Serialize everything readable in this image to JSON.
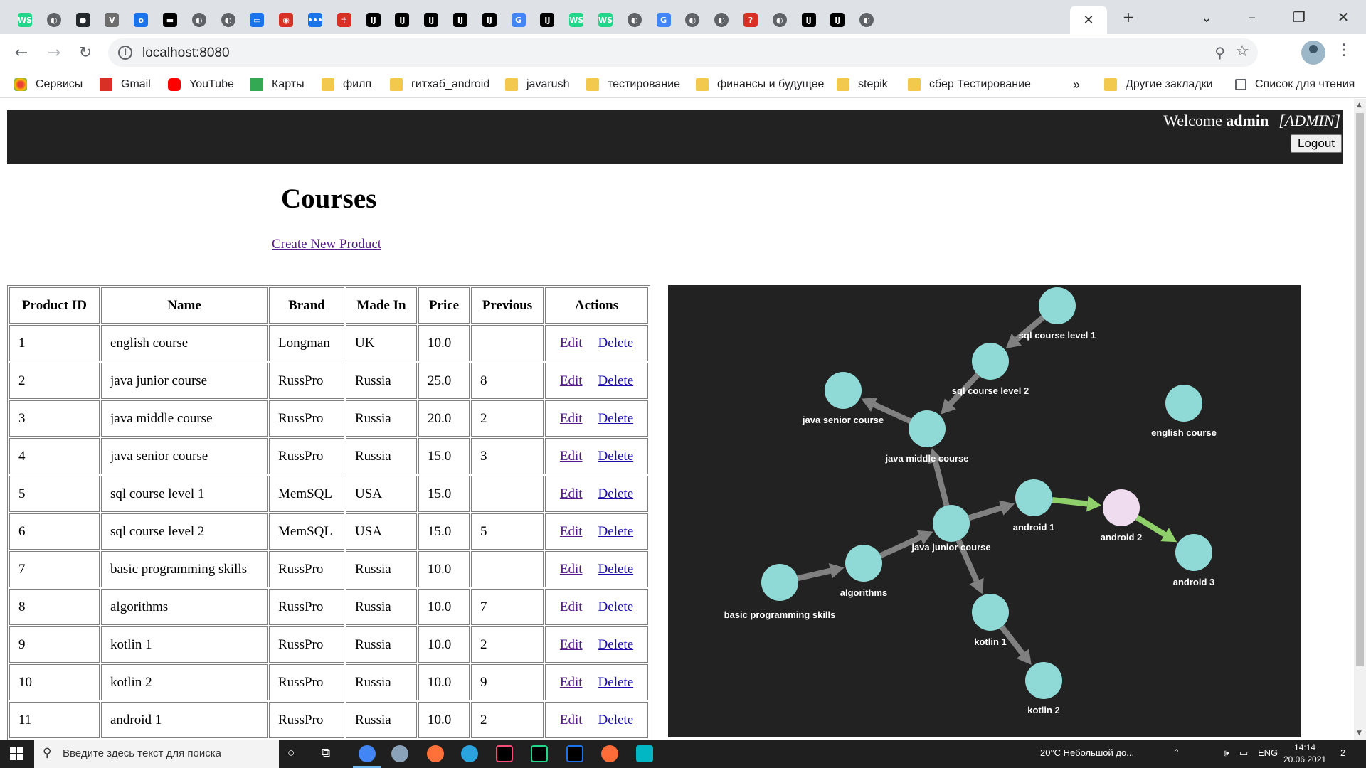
{
  "browser": {
    "tabs": [
      {
        "icon": "webstorm-icon",
        "color": "#21d789"
      },
      {
        "icon": "globe-icon",
        "color": "#5f6368"
      },
      {
        "icon": "github-icon",
        "color": "#24292e"
      },
      {
        "icon": "v-icon",
        "color": "#6d6d6d"
      },
      {
        "icon": "o-icon",
        "color": "#1a73e8"
      },
      {
        "icon": "chat-icon",
        "color": "#000000"
      },
      {
        "icon": "globe-icon",
        "color": "#5f6368"
      },
      {
        "icon": "globe-icon",
        "color": "#5f6368"
      },
      {
        "icon": "message-icon",
        "color": "#1a73e8"
      },
      {
        "icon": "record-icon",
        "color": "#d93025"
      },
      {
        "icon": "dots-icon",
        "color": "#1a73e8"
      },
      {
        "icon": "figure-icon",
        "color": "#d93025"
      },
      {
        "icon": "intellij-icon",
        "color": "#000000"
      },
      {
        "icon": "intellij-icon",
        "color": "#000000"
      },
      {
        "icon": "intellij-icon",
        "color": "#000000"
      },
      {
        "icon": "intellij-icon",
        "color": "#000000"
      },
      {
        "icon": "intellij-icon",
        "color": "#000000"
      },
      {
        "icon": "google-icon",
        "color": "#4285f4"
      },
      {
        "icon": "intellij-icon",
        "color": "#000000"
      },
      {
        "icon": "webstorm-icon",
        "color": "#21d789"
      },
      {
        "icon": "webstorm-icon",
        "color": "#21d789"
      },
      {
        "icon": "globe-icon",
        "color": "#5f6368"
      },
      {
        "icon": "google-icon",
        "color": "#4285f4"
      },
      {
        "icon": "globe-icon",
        "color": "#5f6368"
      },
      {
        "icon": "globe-icon",
        "color": "#5f6368"
      },
      {
        "icon": "question-icon",
        "color": "#d93025"
      },
      {
        "icon": "globe-icon",
        "color": "#5f6368"
      },
      {
        "icon": "intellij-icon",
        "color": "#000000"
      },
      {
        "icon": "intellij-icon",
        "color": "#000000"
      },
      {
        "icon": "globe-icon",
        "color": "#5f6368"
      }
    ],
    "url": "localhost:8080",
    "bookmarks": [
      {
        "label": "Сервисы",
        "icon": "apps-icon",
        "color": "#ea4335"
      },
      {
        "label": "Gmail",
        "icon": "gmail-icon",
        "color": "#d93025"
      },
      {
        "label": "YouTube",
        "icon": "youtube-icon",
        "color": "#ff0000"
      },
      {
        "label": "Карты",
        "icon": "maps-icon",
        "color": "#34a853"
      },
      {
        "label": "филп",
        "icon": "folder-icon",
        "color": "#f2c94c"
      },
      {
        "label": "гитхаб_android",
        "icon": "folder-icon",
        "color": "#f2c94c"
      },
      {
        "label": "javarush",
        "icon": "folder-icon",
        "color": "#f2c94c"
      },
      {
        "label": "тестирование",
        "icon": "folder-icon",
        "color": "#f2c94c"
      },
      {
        "label": "финансы и будущее",
        "icon": "folder-icon",
        "color": "#f2c94c"
      },
      {
        "label": "stepik",
        "icon": "folder-icon",
        "color": "#f2c94c"
      },
      {
        "label": "сбер Тестирование",
        "icon": "folder-icon",
        "color": "#f2c94c"
      }
    ],
    "more_bookmarks": "»",
    "other_bookmarks": "Другие закладки",
    "reading_list": "Список для чтения"
  },
  "header": {
    "welcome": "Welcome",
    "user": "admin",
    "role": "[ADMIN]",
    "logout": "Logout"
  },
  "page": {
    "title": "Courses",
    "create_link": "Create New Product"
  },
  "table": {
    "columns": [
      "Product ID",
      "Name",
      "Brand",
      "Made In",
      "Price",
      "Previous",
      "Actions"
    ],
    "edit_label": "Edit",
    "delete_label": "Delete",
    "rows": [
      {
        "id": "1",
        "name": "english course",
        "brand": "Longman",
        "made_in": "UK",
        "price": "10.0",
        "previous": ""
      },
      {
        "id": "2",
        "name": "java junior course",
        "brand": "RussPro",
        "made_in": "Russia",
        "price": "25.0",
        "previous": "8"
      },
      {
        "id": "3",
        "name": "java middle course",
        "brand": "RussPro",
        "made_in": "Russia",
        "price": "20.0",
        "previous": "2"
      },
      {
        "id": "4",
        "name": "java senior course",
        "brand": "RussPro",
        "made_in": "Russia",
        "price": "15.0",
        "previous": "3"
      },
      {
        "id": "5",
        "name": "sql course level 1",
        "brand": "MemSQL",
        "made_in": "USA",
        "price": "15.0",
        "previous": ""
      },
      {
        "id": "6",
        "name": "sql course level 2",
        "brand": "MemSQL",
        "made_in": "USA",
        "price": "15.0",
        "previous": "5"
      },
      {
        "id": "7",
        "name": "basic programming skills",
        "brand": "RussPro",
        "made_in": "Russia",
        "price": "10.0",
        "previous": ""
      },
      {
        "id": "8",
        "name": "algorithms",
        "brand": "RussPro",
        "made_in": "Russia",
        "price": "10.0",
        "previous": "7"
      },
      {
        "id": "9",
        "name": "kotlin 1",
        "brand": "RussPro",
        "made_in": "Russia",
        "price": "10.0",
        "previous": "2"
      },
      {
        "id": "10",
        "name": "kotlin 2",
        "brand": "RussPro",
        "made_in": "Russia",
        "price": "10.0",
        "previous": "9"
      },
      {
        "id": "11",
        "name": "android 1",
        "brand": "RussPro",
        "made_in": "Russia",
        "price": "10.0",
        "previous": "2"
      }
    ]
  },
  "graph": {
    "background": "#222222",
    "node_color": "#8fdad6",
    "highlight_node_color": "#efdcef",
    "edge_color": "#808080",
    "highlight_edge_color": "#8fd06a",
    "label_color": "#ffffff",
    "nodes": [
      {
        "id": "english",
        "label": "english course"
      },
      {
        "id": "java_junior",
        "label": "java junior course"
      },
      {
        "id": "java_middle",
        "label": "java middle course"
      },
      {
        "id": "java_senior",
        "label": "java senior course"
      },
      {
        "id": "sql1",
        "label": "sql course level 1"
      },
      {
        "id": "sql2",
        "label": "sql course level 2"
      },
      {
        "id": "basic",
        "label": "basic programming skills"
      },
      {
        "id": "algorithms",
        "label": "algorithms"
      },
      {
        "id": "kotlin1",
        "label": "kotlin 1"
      },
      {
        "id": "kotlin2",
        "label": "kotlin 2"
      },
      {
        "id": "android1",
        "label": "android 1"
      },
      {
        "id": "android2",
        "label": "android 2",
        "highlight": true
      },
      {
        "id": "android3",
        "label": "android 3"
      }
    ],
    "edges": [
      {
        "from": "sql1",
        "to": "sql2"
      },
      {
        "from": "sql2",
        "to": "java_middle"
      },
      {
        "from": "java_middle",
        "to": "java_senior"
      },
      {
        "from": "java_junior",
        "to": "java_middle"
      },
      {
        "from": "basic",
        "to": "algorithms"
      },
      {
        "from": "algorithms",
        "to": "java_junior"
      },
      {
        "from": "java_junior",
        "to": "android1"
      },
      {
        "from": "java_junior",
        "to": "kotlin1"
      },
      {
        "from": "kotlin1",
        "to": "kotlin2"
      },
      {
        "from": "android1",
        "to": "android2",
        "highlight": true
      },
      {
        "from": "android2",
        "to": "android3",
        "highlight": true
      }
    ]
  },
  "taskbar": {
    "search_placeholder": "Введите здесь текст для поиска",
    "weather": "20°C  Небольшой до...",
    "language": "ENG",
    "time": "14:14",
    "date": "20.06.2021",
    "notifications": "2"
  }
}
